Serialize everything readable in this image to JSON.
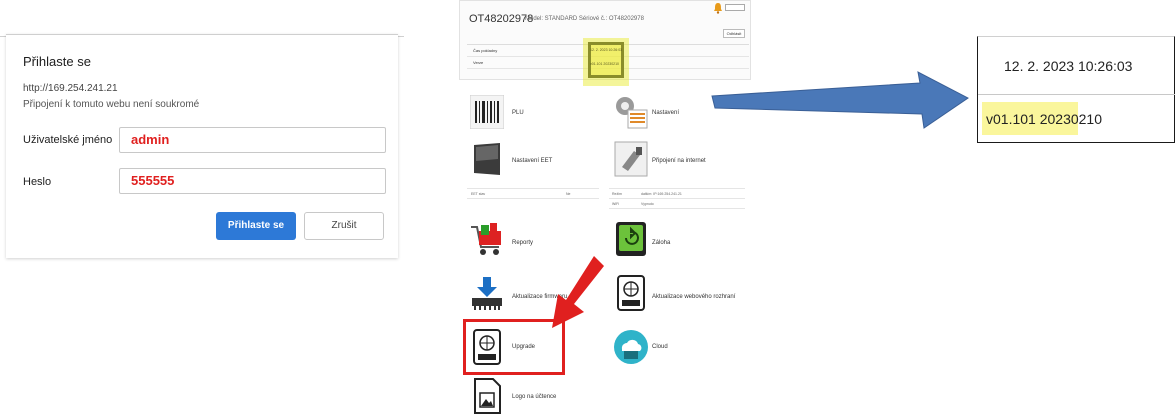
{
  "login_dialog": {
    "title": "Přihlaste se",
    "url": "http://169.254.241.21",
    "note": "Připojení k tomuto webu není soukromé",
    "username_label": "Uživatelské jméno",
    "username_value": "admin",
    "password_label": "Heslo",
    "password_value": "555555",
    "login_button": "Přihlaste se",
    "cancel_button": "Zrušit"
  },
  "panel": {
    "serial": "OT48202978",
    "model": "Model: STANDARD Sériové č.: OT48202978",
    "logout": "Odhlásit",
    "info_rows": [
      "Čas pokladny",
      "Verze"
    ],
    "highlight_lines": [
      "12. 2. 2023 10:26:03",
      "v01.101 20230210"
    ],
    "tiles": {
      "plu": "PLU",
      "settings": "Nastavení",
      "eet": "Nastavení EET",
      "internet": "Připojení na internet",
      "reports": "Reporty",
      "backup": "Záloha",
      "firmware": "Aktualizace firmwaru",
      "web_update": "Aktualizace webového rozhraní",
      "upgrade": "Upgrade",
      "cloud": "Cloud",
      "logo": "Logo na účtence"
    },
    "eet_row": [
      "EET stav",
      "Ne"
    ],
    "net_row": [
      "Režim",
      "dalším: IP:169.254.241.21"
    ],
    "net_row2": [
      "WiFi",
      "Vypnuto"
    ]
  },
  "zoom": {
    "datetime": "12. 2. 2023 10:26:03",
    "version": "v01.101 20230210"
  },
  "colors": {
    "primary_button": "#2d79d7",
    "credential_text": "#e0201f",
    "highlight": "#f3ee5a",
    "arrow_blue": "#4a78b8",
    "arrow_red": "#e0201f"
  }
}
